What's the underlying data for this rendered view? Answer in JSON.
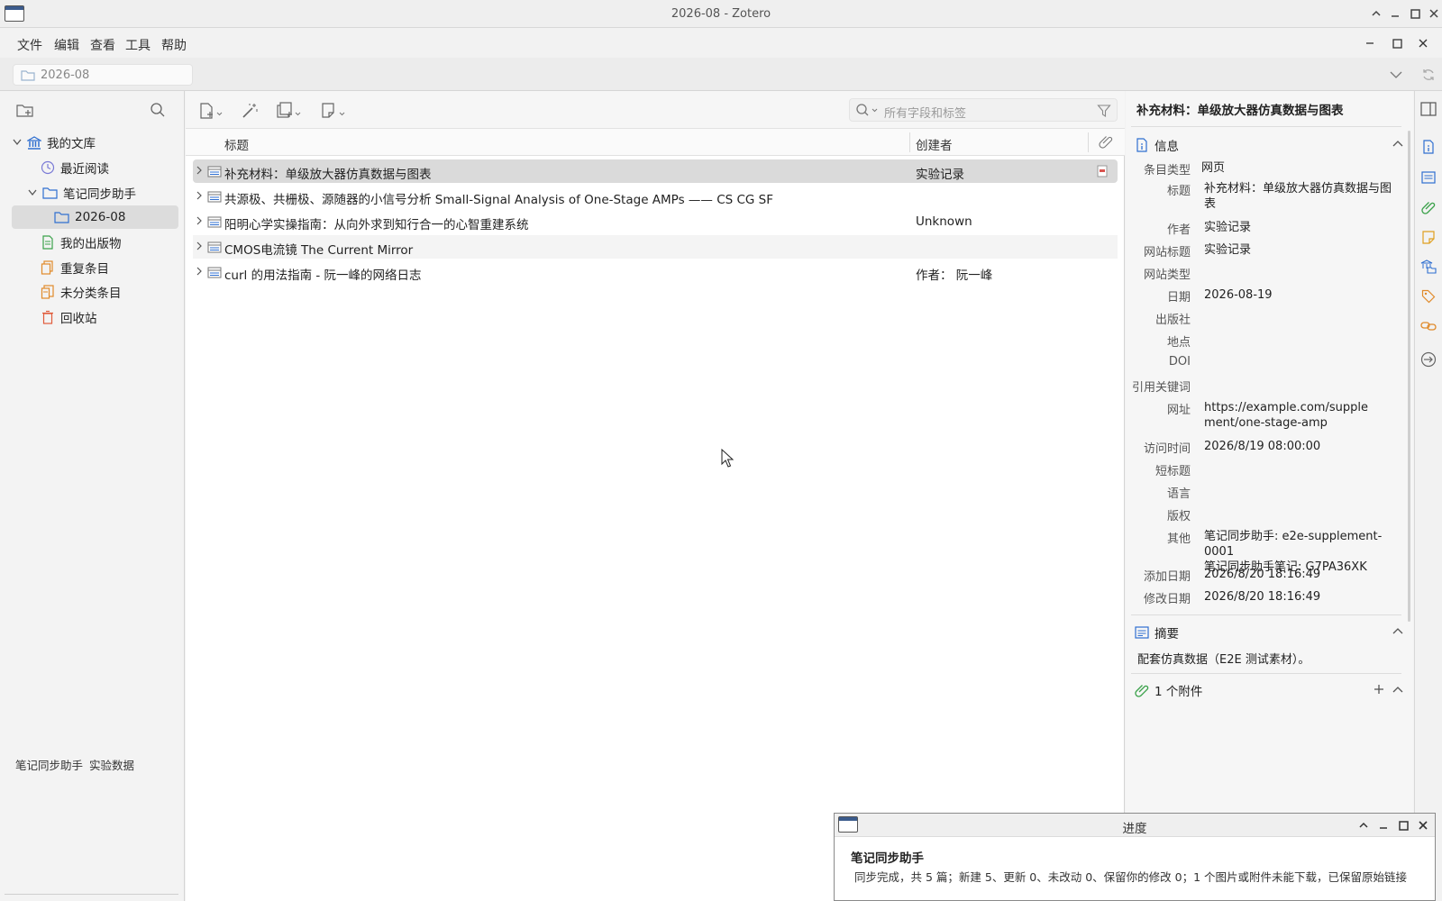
{
  "window": {
    "title": "2026-08 - Zotero"
  },
  "menu": [
    "文件",
    "编辑",
    "查看",
    "工具",
    "帮助"
  ],
  "tab": {
    "label": "2026-08"
  },
  "left_pane": {
    "tree": [
      {
        "label": "我的文库"
      },
      {
        "label": "最近阅读"
      },
      {
        "label": "笔记同步助手"
      },
      {
        "label": "2026-08"
      },
      {
        "label": "我的出版物"
      },
      {
        "label": "重复条目"
      },
      {
        "label": "未分类条目"
      },
      {
        "label": "回收站"
      }
    ],
    "tags": [
      "笔记同步助手",
      "实验数据"
    ]
  },
  "search": {
    "placeholder": "所有字段和标签"
  },
  "columns": {
    "title": "标题",
    "creator": "创建者"
  },
  "items": [
    {
      "title": "补充材料：单级放大器仿真数据与图表",
      "creator": "实验记录"
    },
    {
      "title": "共源极、共栅极、源随器的小信号分析 Small-Signal Analysis of One-Stage AMPs —— CS CG SF",
      "creator": ""
    },
    {
      "title": "阳明心学实操指南：从向外求到知行合一的心智重建系统",
      "creator": "Unknown"
    },
    {
      "title": "CMOS电流镜 The Current Mirror",
      "creator": ""
    },
    {
      "title": "curl 的用法指南 - 阮一峰的网络日志",
      "creator": "作者： 阮一峰"
    }
  ],
  "item_pane": {
    "header": "补充材料：单级放大器仿真数据与图表",
    "info_section": "信息",
    "fields": [
      {
        "label": "条目类型",
        "value": "网页"
      },
      {
        "label": "标题",
        "value": "补充材料：单级放大器仿真数据与图表"
      },
      {
        "label": "作者",
        "value": "实验记录"
      },
      {
        "label": "网站标题",
        "value": "实验记录"
      },
      {
        "label": "网站类型",
        "value": ""
      },
      {
        "label": "日期",
        "value": "2026-08-19"
      },
      {
        "label": "出版社",
        "value": ""
      },
      {
        "label": "地点",
        "value": ""
      },
      {
        "label": "DOI",
        "value": ""
      },
      {
        "label": "引用关键词",
        "value": ""
      },
      {
        "label": "网址",
        "value": "https://example.com/supplement/one-stage-amp"
      },
      {
        "label": "访问时间",
        "value": "2026/8/19 08:00:00"
      },
      {
        "label": "短标题",
        "value": ""
      },
      {
        "label": "语言",
        "value": ""
      },
      {
        "label": "版权",
        "value": ""
      },
      {
        "label": "其他",
        "value": "笔记同步助手: e2e-supplement-0001\n笔记同步助手笔记: G7PA36XK"
      },
      {
        "label": "添加日期",
        "value": "2026/8/20 18:16:49"
      },
      {
        "label": "修改日期",
        "value": "2026/8/20 18:16:49"
      }
    ],
    "abstract_section": "摘要",
    "abstract": "配套仿真数据（E2E 测试素材）。",
    "attachments_section": "1 个附件"
  },
  "progress_dialog": {
    "title": "进度",
    "heading": "笔记同步助手",
    "message": "同步完成，共 5 篇；新建 5、更新 0、未改动 0、保留你的修改 0；1 个图片或附件未能下载，已保留原始链接"
  },
  "colors": {
    "selection": "#dadada",
    "accent": "#2f6fd0",
    "tag_orange": "#e08a2a",
    "green": "#3aa14a"
  }
}
